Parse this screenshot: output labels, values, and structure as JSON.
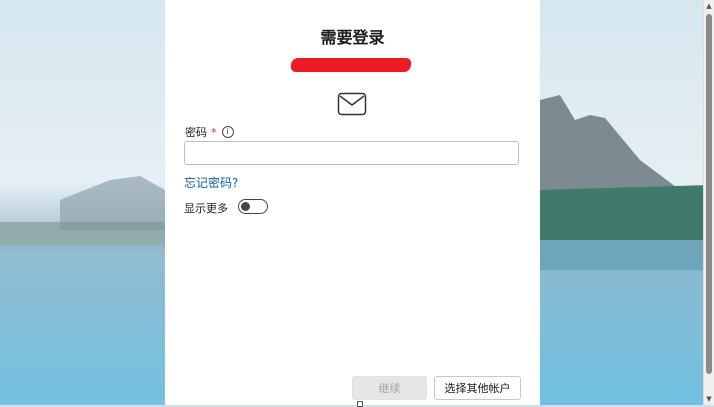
{
  "dialog": {
    "title": "需要登录",
    "password_label": "密码",
    "required_marker": "*",
    "info_glyph": "i",
    "password_value": "",
    "forgot_password": "忘记密码?",
    "show_more_label": "显示更多",
    "show_more_on": false,
    "continue_button": "继续",
    "other_account_button": "选择其他帐户"
  },
  "icons": {
    "mail": "mail-icon",
    "info": "info-icon"
  },
  "colors": {
    "link": "#0f5fa8",
    "required": "#c42b1c",
    "redaction": "#ee1b24",
    "disabled_button": "#e6e6e6"
  }
}
